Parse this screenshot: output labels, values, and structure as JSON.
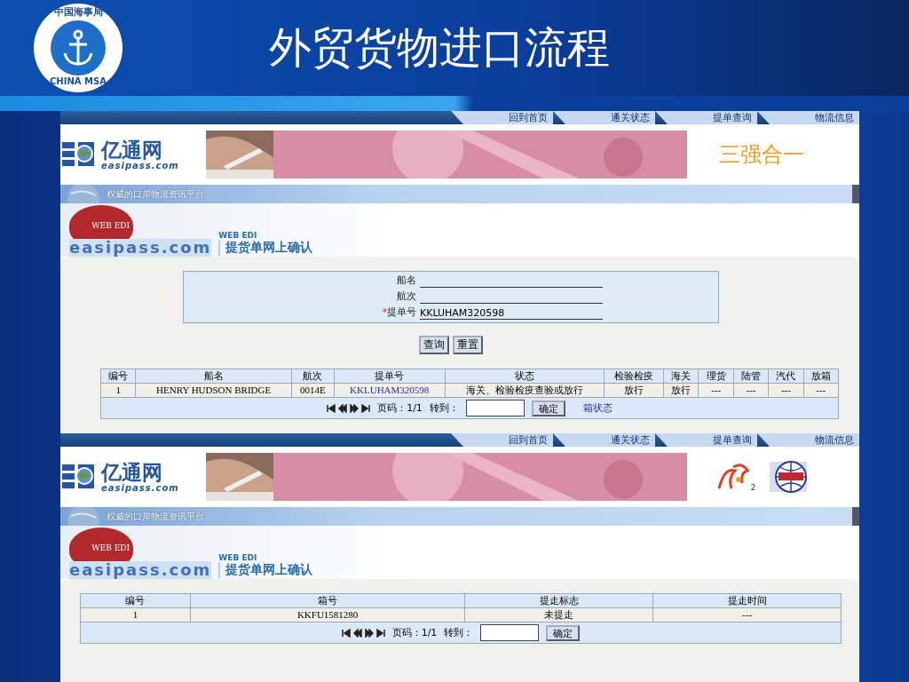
{
  "slide": {
    "title": "外贸货物进口流程",
    "logo": {
      "top_text": "中国海事局",
      "bottom_text": "CHINA MSA"
    }
  },
  "screens": [
    {
      "nav": [
        "回到首页",
        "通关状态",
        "提单查询",
        "物流信息"
      ],
      "brand": {
        "name": "亿通网",
        "domain": "easipass.com"
      },
      "banner": {
        "kind": "picture"
      },
      "tagline": "三强合一",
      "slogan": "权威的口岸物流资讯平台",
      "edi": {
        "badge": "WEB EDI",
        "domain": "easipass.com",
        "label": "WEB EDI",
        "page_title": "提货单网上确认"
      },
      "form": {
        "fields": [
          {
            "label": "船名"
          },
          {
            "label": "航次"
          },
          {
            "label": "提单号",
            "required_mark": "*",
            "value": "KKLUHAM320598"
          }
        ],
        "buttons": [
          "查询",
          "重置"
        ]
      },
      "table": {
        "columns": [
          {
            "label": "编号",
            "kind": "text"
          },
          {
            "label": "船名",
            "kind": "text"
          },
          {
            "label": "航次",
            "kind": "text"
          },
          {
            "label": "提单号",
            "kind": "link"
          },
          {
            "label": "状态",
            "kind": "text"
          },
          {
            "label": "检验检疫",
            "kind": "text"
          },
          {
            "label": "海关",
            "kind": "text"
          },
          {
            "label": "理货",
            "kind": "text"
          },
          {
            "label": "陆管",
            "kind": "text"
          },
          {
            "label": "汽代",
            "kind": "text"
          },
          {
            "label": "放箱",
            "kind": "text"
          }
        ],
        "rows": [
          [
            "1",
            "HENRY HUDSON BRIDGE",
            "0014E",
            "KKLUHAM320598",
            "海关、检验检疫查验或放行",
            "放行",
            "放行",
            "---",
            "---",
            "---",
            "---"
          ]
        ],
        "pager": {
          "page": "页码：1/1",
          "goto": "转到：",
          "confirm": "确定",
          "link": "箱状态"
        }
      }
    },
    {
      "nav": [
        "回到首页",
        "通关状态",
        "提单查询",
        "物流信息"
      ],
      "brand": {
        "name": "亿通网",
        "domain": "easipass.com"
      },
      "banner": {
        "kind": "picture"
      },
      "partners": [
        {
          "kind": "swirl",
          "mark": "2"
        },
        {
          "kind": "globe"
        }
      ],
      "slogan": "权威的口岸物流资讯平台",
      "edi": {
        "badge": "WEB EDI",
        "domain": "easipass.com",
        "label": "WEB EDI",
        "page_title": "提货单网上确认"
      },
      "table": {
        "columns": [
          {
            "label": "编号",
            "kind": "text"
          },
          {
            "label": "箱号",
            "kind": "text"
          },
          {
            "label": "提走标志",
            "kind": "text"
          },
          {
            "label": "提走时间",
            "kind": "text"
          }
        ],
        "rows": [
          [
            "1",
            "KKFU1581280",
            "未提走",
            "---"
          ]
        ],
        "pager": {
          "page": "页码：1/1",
          "goto": "转到：",
          "confirm": "确定"
        }
      }
    }
  ]
}
